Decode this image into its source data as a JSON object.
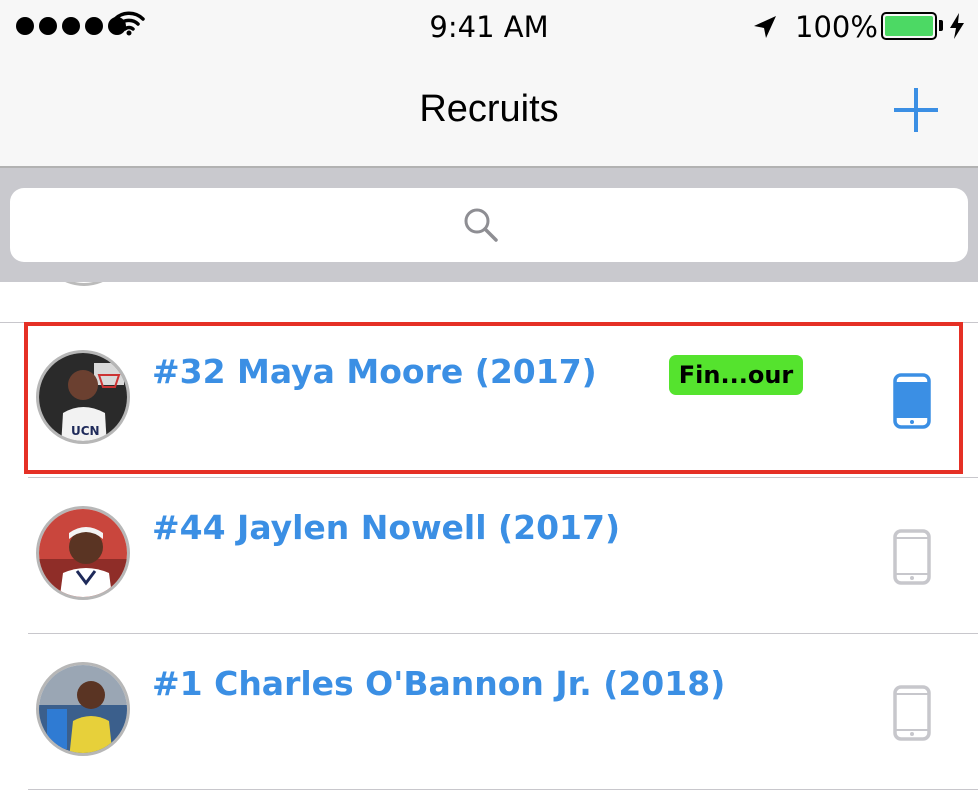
{
  "status_bar": {
    "time": "9:41 AM",
    "battery_percent": "100%",
    "battery_level": 1.0
  },
  "nav": {
    "title": "Recruits",
    "add_icon": "plus-icon"
  },
  "search": {
    "placeholder": "",
    "value": "",
    "icon": "search-icon"
  },
  "recruits": [
    {
      "name": "#32 Maya Moore (2017)",
      "tag": "Fin...our",
      "device_active": true,
      "device_icon": "phone-icon"
    },
    {
      "name": "#44 Jaylen Nowell (2017)",
      "tag": "",
      "device_active": false,
      "device_icon": "phone-icon"
    },
    {
      "name": "#1 Charles O'Bannon Jr. (2018)",
      "tag": "",
      "device_active": false,
      "device_icon": "phone-icon"
    }
  ],
  "colors": {
    "accent_blue": "#3b8fe4",
    "tag_green": "#55e32e",
    "highlight_red": "#e53025",
    "device_inactive": "#c7c7cc"
  }
}
